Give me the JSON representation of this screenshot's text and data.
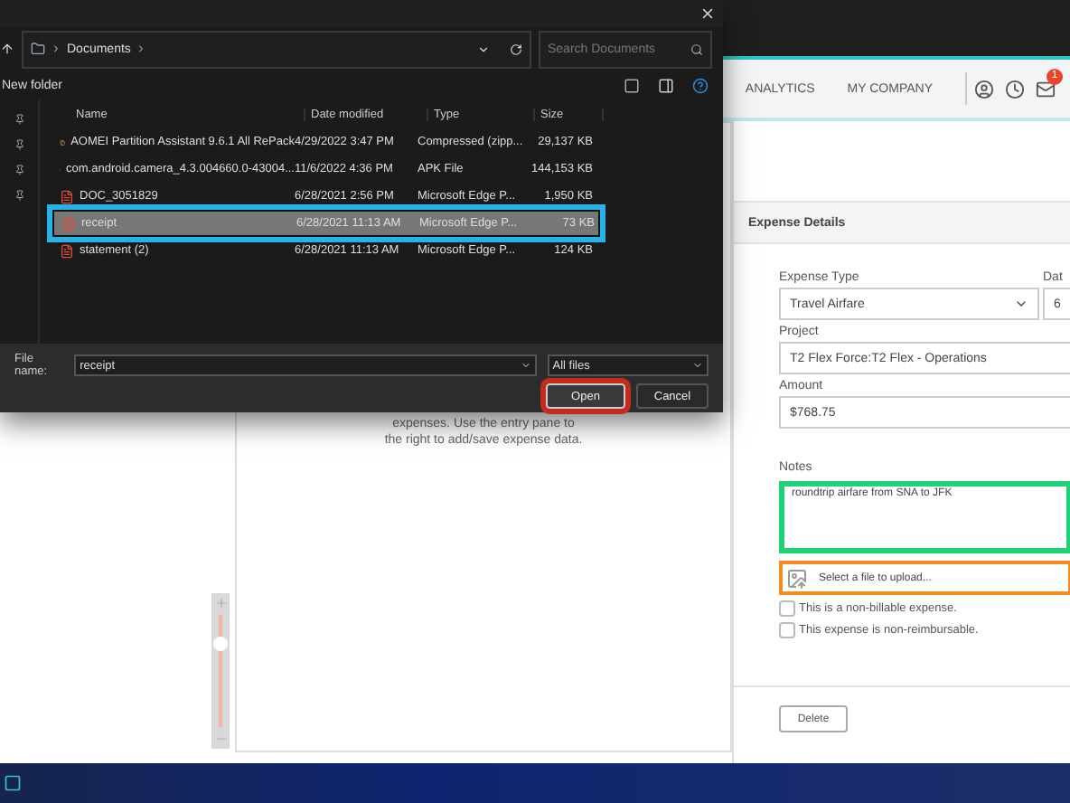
{
  "dialog": {
    "address": "Documents",
    "search_placeholder": "Search Documents",
    "new_folder": "New folder",
    "columns": [
      "Name",
      "Date modified",
      "Type",
      "Size"
    ],
    "files": [
      {
        "kind": "zip",
        "name": "AOMEI Partition Assistant 9.6.1 All RePack",
        "date": "4/29/2022 3:47 PM",
        "type": "Compressed (zipp...",
        "size": "29,137 KB",
        "selected": false,
        "highlighted": false
      },
      {
        "kind": "apk",
        "name": "com.android.camera_4.3.004660.0-43004...",
        "date": "11/6/2022 4:36 PM",
        "type": "APK File",
        "size": "144,153 KB",
        "selected": false,
        "highlighted": false
      },
      {
        "kind": "pdf",
        "name": "DOC_3051829",
        "date": "6/28/2021 2:56 PM",
        "type": "Microsoft Edge P...",
        "size": "1,950 KB",
        "selected": false,
        "highlighted": false
      },
      {
        "kind": "pdf",
        "name": "receipt",
        "date": "6/28/2021 11:13 AM",
        "type": "Microsoft Edge P...",
        "size": "73 KB",
        "selected": true,
        "highlighted": true
      },
      {
        "kind": "pdf",
        "name": "statement (2)",
        "date": "6/28/2021 11:13 AM",
        "type": "Microsoft Edge P...",
        "size": "124 KB",
        "selected": false,
        "highlighted": false
      }
    ],
    "file_name_label": "File name:",
    "file_name": "receipt",
    "file_type": "All files",
    "buttons": [
      {
        "label": "Open",
        "default": true,
        "highlighted": true
      },
      {
        "label": "Cancel",
        "default": false,
        "highlighted": false
      }
    ]
  },
  "nav": {
    "items": [
      "ANALYTICS",
      "MY COMPANY"
    ],
    "badge": "1"
  },
  "list_pane": {
    "message": "expenses. Use the entry pane to the right to add/save expense data."
  },
  "zoom_slider": {
    "level": 0.75
  },
  "expense": {
    "title": "Expense Details",
    "type_label": "Expense Type",
    "type_value": "Travel Airfare",
    "date_label": "Dat",
    "date_value": "6",
    "fields": [
      {
        "label": "Project",
        "value": "T2 Flex Force:T2 Flex - Operations"
      },
      {
        "label": "Amount",
        "value": "$768.75"
      }
    ],
    "notes_label": "Notes",
    "notes": "roundtrip airfare from SNA to JFK",
    "notes_highlighted": true,
    "upload": "Select a file to upload...",
    "upload_highlighted": true,
    "checkboxes": [
      {
        "label": "This is a non-billable expense.",
        "checked": false
      },
      {
        "label": "This expense is non-reimbursable.",
        "checked": false
      }
    ],
    "delete": "Delete"
  }
}
